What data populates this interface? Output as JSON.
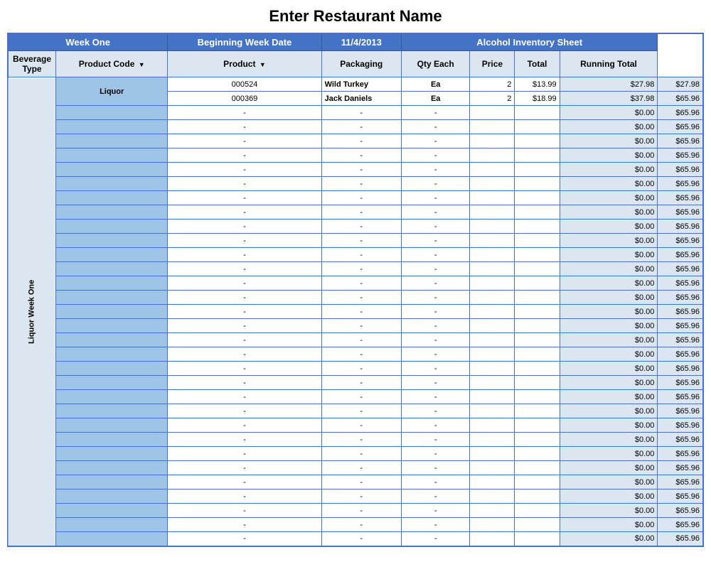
{
  "title": "Enter Restaurant Name",
  "header": {
    "week_one": "Week One",
    "beginning_week_date": "Beginning Week Date",
    "date_value": "11/4/2013",
    "alcohol_inventory_sheet": "Alcohol Inventory Sheet"
  },
  "columns": {
    "beverage_type": "Beverage Type",
    "product_code": "Product Code",
    "product": "Product",
    "packaging": "Packaging",
    "qty_each": "Qty Each",
    "price": "Price",
    "total": "Total",
    "running_total": "Running Total"
  },
  "sidebar_label": "Liquor Week One",
  "rows": [
    {
      "beverage_type": "Liquor",
      "product_code": "000524",
      "product": "Wild Turkey",
      "packaging": "Ea",
      "qty": "2",
      "price": "$13.99",
      "total": "$27.98",
      "running_total": "$27.98",
      "is_data": true
    },
    {
      "beverage_type": "",
      "product_code": "000369",
      "product": "Jack Daniels",
      "packaging": "Ea",
      "qty": "2",
      "price": "$18.99",
      "total": "$37.98",
      "running_total": "$65.96",
      "is_data": true
    },
    {
      "total": "$0.00",
      "running_total": "$65.96"
    },
    {
      "total": "$0.00",
      "running_total": "$65.96"
    },
    {
      "total": "$0.00",
      "running_total": "$65.96"
    },
    {
      "total": "$0.00",
      "running_total": "$65.96"
    },
    {
      "total": "$0.00",
      "running_total": "$65.96"
    },
    {
      "total": "$0.00",
      "running_total": "$65.96"
    },
    {
      "total": "$0.00",
      "running_total": "$65.96"
    },
    {
      "total": "$0.00",
      "running_total": "$65.96"
    },
    {
      "total": "$0.00",
      "running_total": "$65.96"
    },
    {
      "total": "$0.00",
      "running_total": "$65.96"
    },
    {
      "total": "$0.00",
      "running_total": "$65.96"
    },
    {
      "total": "$0.00",
      "running_total": "$65.96"
    },
    {
      "total": "$0.00",
      "running_total": "$65.96"
    },
    {
      "total": "$0.00",
      "running_total": "$65.96"
    },
    {
      "total": "$0.00",
      "running_total": "$65.96"
    },
    {
      "total": "$0.00",
      "running_total": "$65.96"
    },
    {
      "total": "$0.00",
      "running_total": "$65.96"
    },
    {
      "total": "$0.00",
      "running_total": "$65.96"
    },
    {
      "total": "$0.00",
      "running_total": "$65.96"
    },
    {
      "total": "$0.00",
      "running_total": "$65.96"
    },
    {
      "total": "$0.00",
      "running_total": "$65.96"
    },
    {
      "total": "$0.00",
      "running_total": "$65.96"
    },
    {
      "total": "$0.00",
      "running_total": "$65.96"
    },
    {
      "total": "$0.00",
      "running_total": "$65.96"
    },
    {
      "total": "$0.00",
      "running_total": "$65.96"
    },
    {
      "total": "$0.00",
      "running_total": "$65.96"
    },
    {
      "total": "$0.00",
      "running_total": "$65.96"
    },
    {
      "total": "$0.00",
      "running_total": "$65.96"
    },
    {
      "total": "$0.00",
      "running_total": "$65.96"
    },
    {
      "total": "$0.00",
      "running_total": "$65.96"
    },
    {
      "total": "$0.00",
      "running_total": "$65.96"
    }
  ]
}
